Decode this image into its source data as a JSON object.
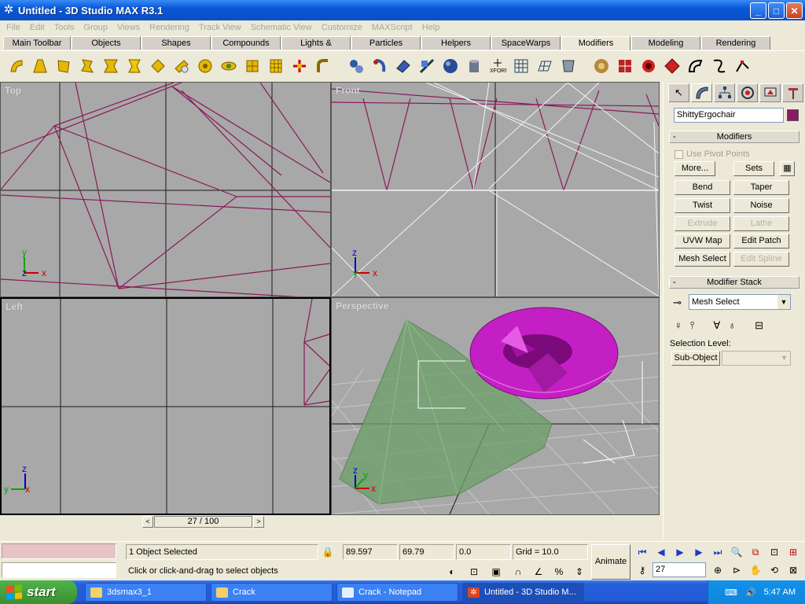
{
  "window": {
    "title": "Untitled - 3D Studio MAX R3.1",
    "app_icon": "max-logo-icon",
    "buttons": {
      "minimize": "_",
      "maximize": "□",
      "close": "✕"
    }
  },
  "menu": [
    "File",
    "Edit",
    "Tools",
    "Group",
    "Views",
    "Rendering",
    "Track View",
    "Schematic View",
    "Customize",
    "MAXScript",
    "Help"
  ],
  "tabs": [
    "Main Toolbar",
    "Objects",
    "Shapes",
    "Compounds",
    "Lights & Cameras",
    "Particles",
    "Helpers",
    "SpaceWarps",
    "Modifiers",
    "Modeling",
    "Rendering"
  ],
  "active_tab": "Modifiers",
  "viewports": {
    "top": {
      "label": "Top"
    },
    "front": {
      "label": "Front"
    },
    "left": {
      "label": "Left"
    },
    "perspective": {
      "label": "Perspective"
    },
    "axis_labels": {
      "x": "x",
      "y": "y",
      "z": "z"
    }
  },
  "command_panel": {
    "object_name": "ShittyErgochair",
    "object_color": "#8a1a66",
    "rollouts": {
      "modifiers": "Modifiers",
      "modifier_stack": "Modifier Stack",
      "collapse": "-"
    },
    "use_pivot_points": "Use Pivot Points",
    "more": "More...",
    "sets": "Sets",
    "modifier_buttons": [
      {
        "label": "Bend",
        "enabled": true
      },
      {
        "label": "Taper",
        "enabled": true
      },
      {
        "label": "Twist",
        "enabled": true
      },
      {
        "label": "Noise",
        "enabled": true
      },
      {
        "label": "Extrude",
        "enabled": false
      },
      {
        "label": "Lathe",
        "enabled": false
      },
      {
        "label": "UVW Map",
        "enabled": true
      },
      {
        "label": "Edit Patch",
        "enabled": true
      },
      {
        "label": "Mesh Select",
        "enabled": true
      },
      {
        "label": "Edit Spline",
        "enabled": false
      }
    ],
    "stack_value": "Mesh Select",
    "selection_level_label": "Selection Level:",
    "sub_object": "Sub-Object"
  },
  "time_slider": {
    "value": "27 / 100",
    "prev": "<",
    "next": ">"
  },
  "status": {
    "selected": "1 Object Selected",
    "prompt": "Click or click-and-drag to select objects",
    "x": "89.597",
    "y": "69.79",
    "z": "0.0",
    "grid": "Grid = 10.0",
    "animate": "Animate",
    "frame": "27"
  },
  "taskbar": {
    "start": "start",
    "tasks": [
      {
        "label": "3dsmax3_1",
        "icon": "folder-icon"
      },
      {
        "label": "Crack",
        "icon": "folder-icon"
      },
      {
        "label": "Crack - Notepad",
        "icon": "notepad-icon"
      },
      {
        "label": "Untitled - 3D Studio M...",
        "icon": "max-icon"
      }
    ],
    "clock": "5:47 AM"
  },
  "colors": {
    "wire": "#8a1a5a",
    "grid_dark": "#1a1a1a",
    "grid_light": "#c8c8c8",
    "viewport_bg": "#a8a8a8",
    "torus": "#c41fc4",
    "pyramid": "#6ea06a"
  }
}
